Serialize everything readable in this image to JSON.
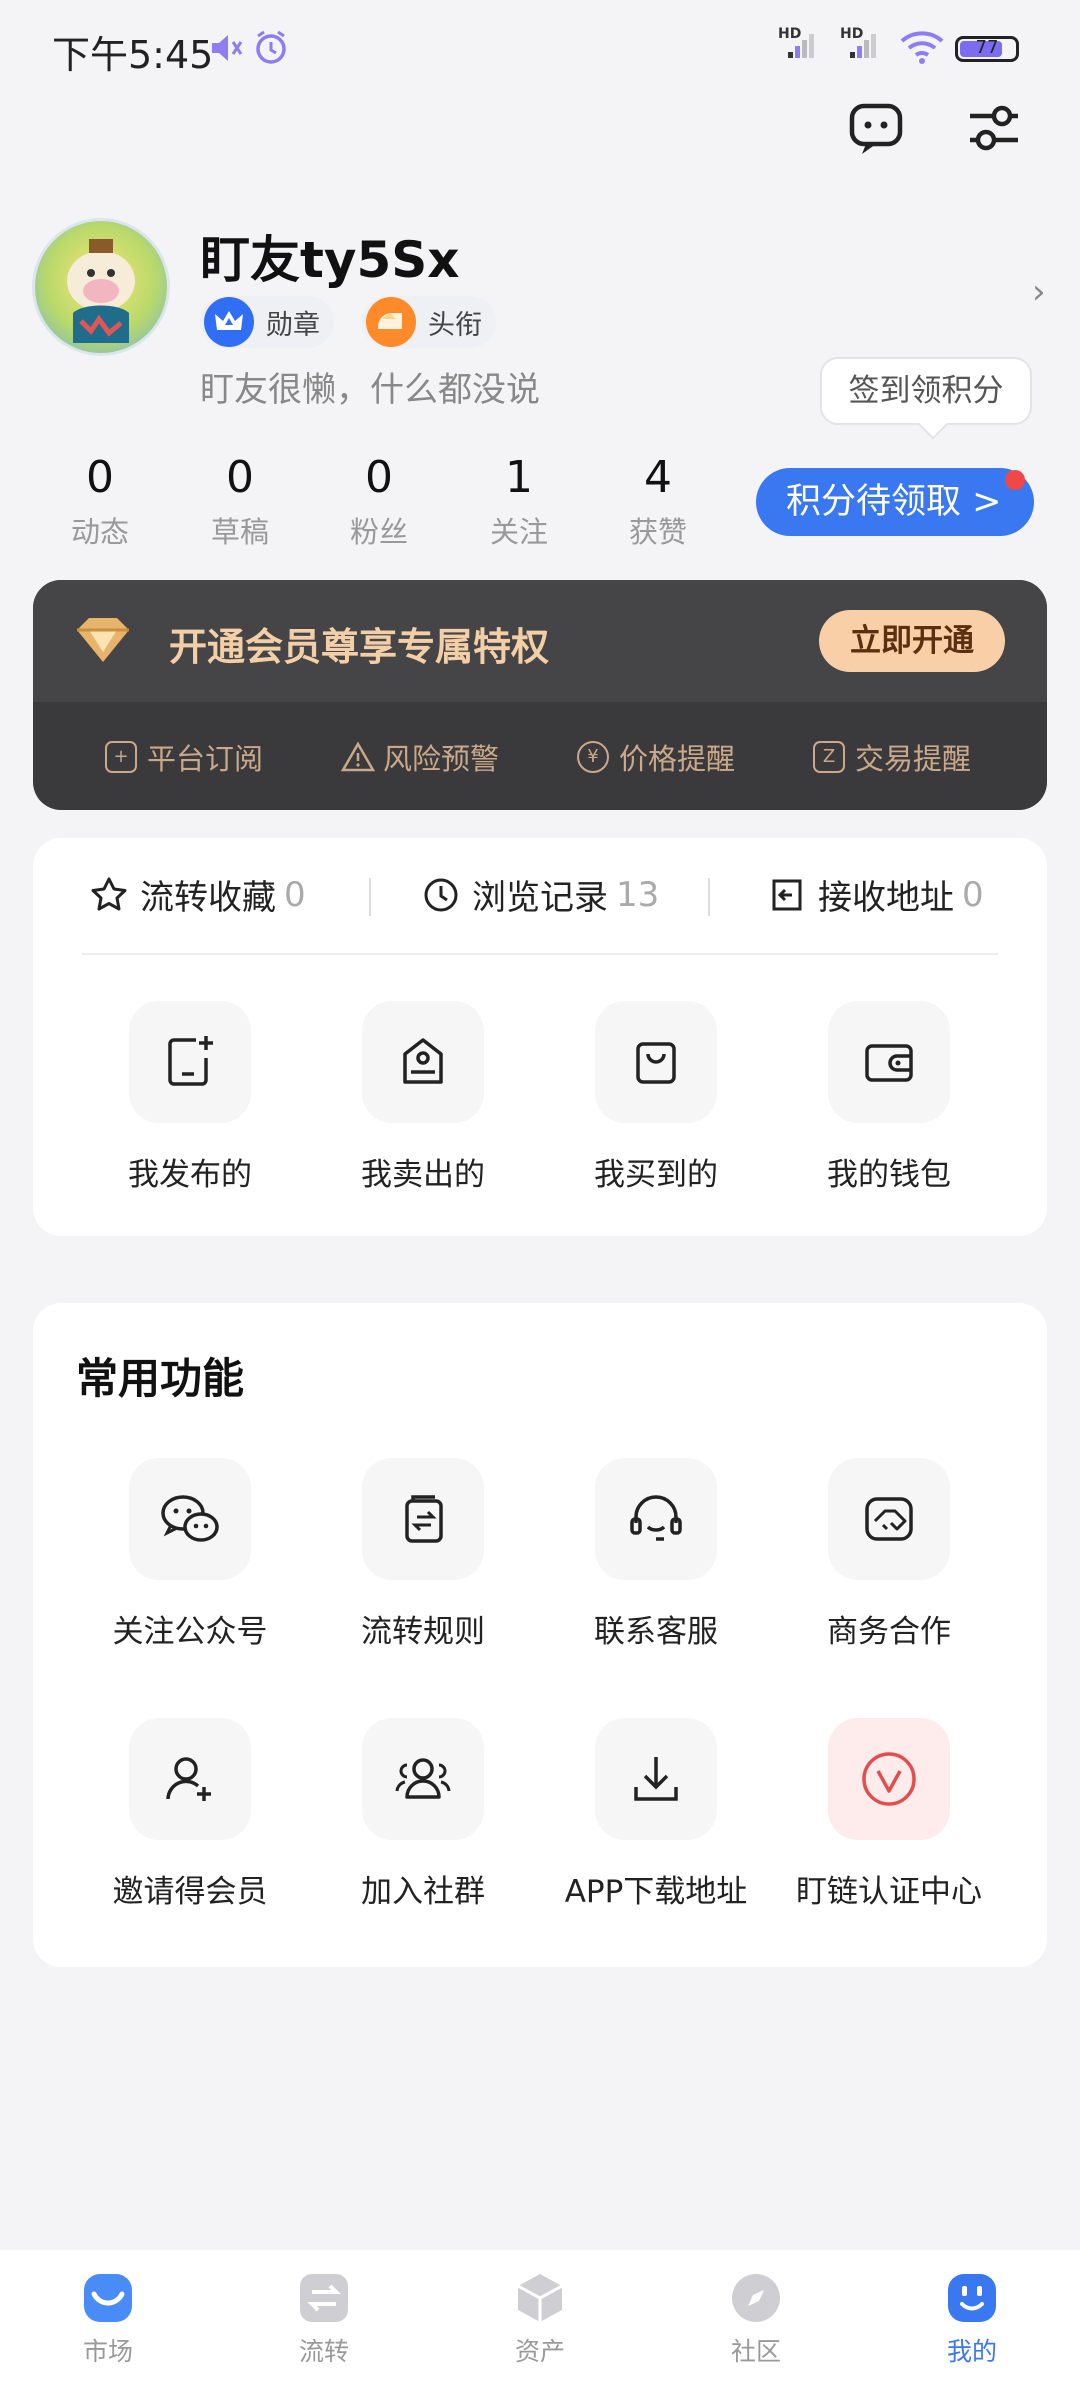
{
  "status": {
    "time": "下午5:45",
    "battery": "77",
    "battery_level": 0.77,
    "signal_labels": [
      "HD",
      "HD"
    ]
  },
  "profile": {
    "username": "盯友ty5Sx",
    "badges": [
      "勋章",
      "头衔"
    ],
    "bio": "盯友很懒，什么都没说",
    "sign_tip": "签到领积分",
    "points_button": "积分待领取 >"
  },
  "stats": [
    {
      "value": "0",
      "label": "动态"
    },
    {
      "value": "0",
      "label": "草稿"
    },
    {
      "value": "0",
      "label": "粉丝"
    },
    {
      "value": "1",
      "label": "关注"
    },
    {
      "value": "4",
      "label": "获赞"
    }
  ],
  "vip": {
    "title": "开通会员尊享专属特权",
    "button": "立即开通",
    "features": [
      "平台订阅",
      "风险预警",
      "价格提醒",
      "交易提醒"
    ]
  },
  "quick_links": [
    {
      "label": "流转收藏",
      "count": "0"
    },
    {
      "label": "浏览记录",
      "count": "13"
    },
    {
      "label": "接收地址",
      "count": "0"
    }
  ],
  "my_items": [
    "我发布的",
    "我卖出的",
    "我买到的",
    "我的钱包"
  ],
  "common": {
    "title": "常用功能",
    "items": [
      "关注公众号",
      "流转规则",
      "联系客服",
      "商务合作",
      "邀请得会员",
      "加入社群",
      "APP下载地址",
      "盯链认证中心"
    ]
  },
  "nav": [
    "市场",
    "流转",
    "资产",
    "社区",
    "我的"
  ],
  "colors": {
    "accent": "#3a78f2",
    "vip_bg": "#3a3a3c",
    "vip_gold": "#f3cfa7",
    "notify_red": "#f04848"
  }
}
